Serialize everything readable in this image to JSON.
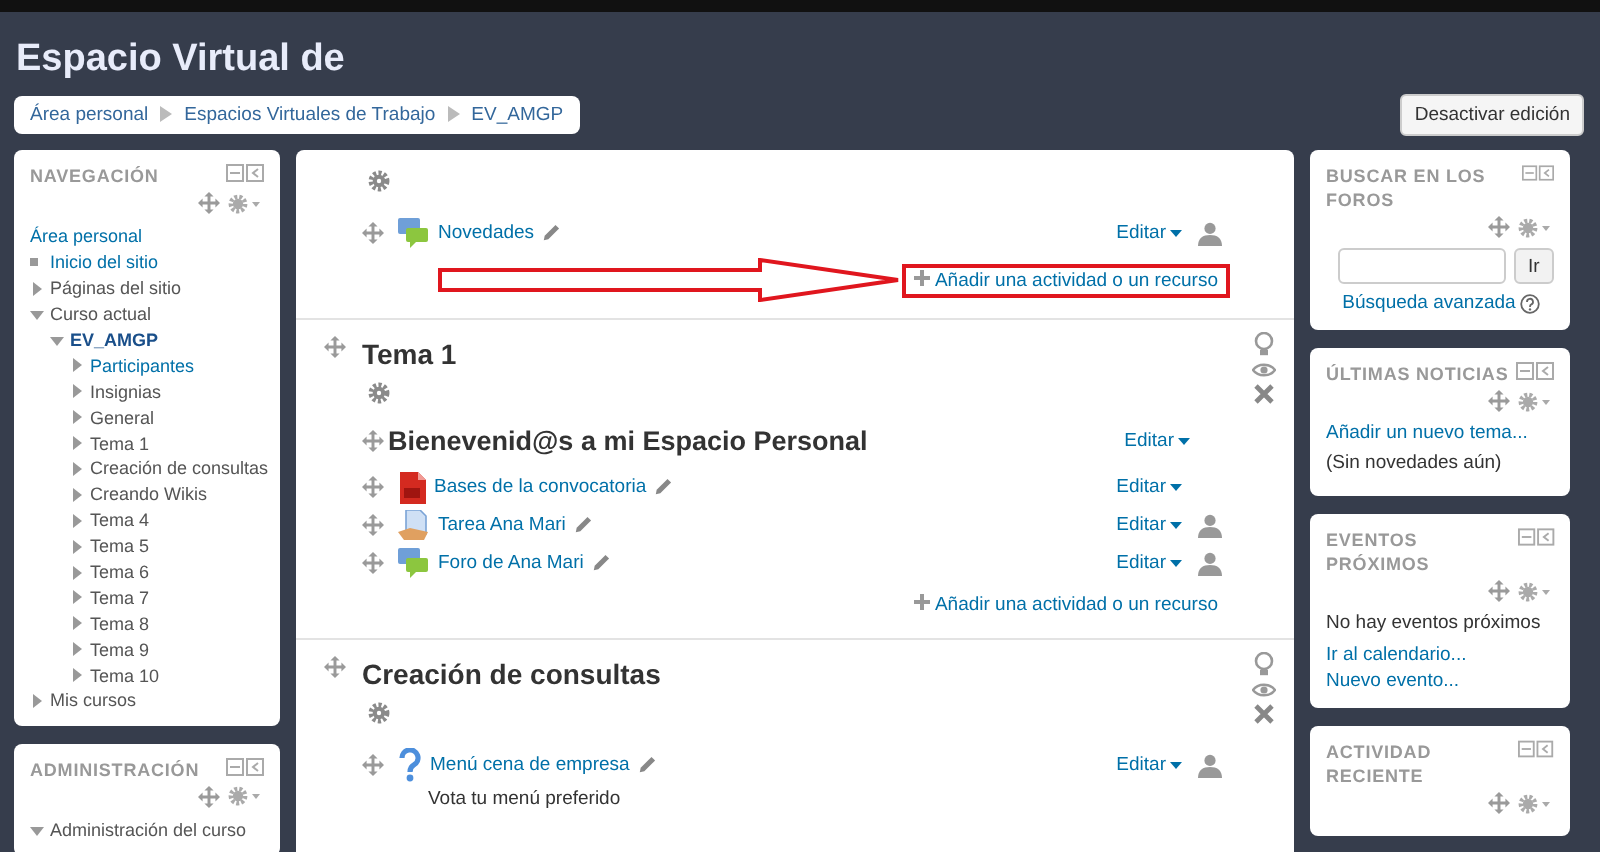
{
  "header": {
    "title": "Espacio Virtual de"
  },
  "breadcrumb": [
    {
      "label": "Área personal"
    },
    {
      "label": "Espacios Virtuales de Trabajo"
    },
    {
      "label": "EV_AMGP"
    }
  ],
  "edit_button": {
    "label": "Desactivar edición"
  },
  "navigation": {
    "title": "NAVEGACIÓN",
    "items": [
      {
        "label": "Área personal",
        "kind": "plain",
        "link": true,
        "current": false
      },
      {
        "label": "Inicio del sitio",
        "kind": "leaf",
        "link": true,
        "current": false
      },
      {
        "label": "Páginas del sitio",
        "kind": "branch",
        "link": false,
        "current": false,
        "expanded": false
      },
      {
        "label": "Curso actual",
        "kind": "branch",
        "link": false,
        "current": false,
        "expanded": true,
        "children": [
          {
            "label": "EV_AMGP",
            "kind": "branch",
            "link": true,
            "current": true,
            "expanded": true,
            "children": [
              {
                "label": "Participantes",
                "kind": "branch",
                "link": true,
                "current": false,
                "expanded": false
              },
              {
                "label": "Insignias",
                "kind": "branch",
                "link": false,
                "current": false,
                "expanded": false
              },
              {
                "label": "General",
                "kind": "branch",
                "link": false,
                "current": false,
                "expanded": false
              },
              {
                "label": "Tema 1",
                "kind": "branch",
                "link": false,
                "current": false,
                "expanded": false
              },
              {
                "label": "Creación de consultas",
                "kind": "branch",
                "link": false,
                "current": false,
                "expanded": false
              },
              {
                "label": "Creando Wikis",
                "kind": "branch",
                "link": false,
                "current": false,
                "expanded": false
              },
              {
                "label": "Tema 4",
                "kind": "branch",
                "link": false,
                "current": false,
                "expanded": false
              },
              {
                "label": "Tema 5",
                "kind": "branch",
                "link": false,
                "current": false,
                "expanded": false
              },
              {
                "label": "Tema 6",
                "kind": "branch",
                "link": false,
                "current": false,
                "expanded": false
              },
              {
                "label": "Tema 7",
                "kind": "branch",
                "link": false,
                "current": false,
                "expanded": false
              },
              {
                "label": "Tema 8",
                "kind": "branch",
                "link": false,
                "current": false,
                "expanded": false
              },
              {
                "label": "Tema 9",
                "kind": "branch",
                "link": false,
                "current": false,
                "expanded": false
              },
              {
                "label": "Tema 10",
                "kind": "branch",
                "link": false,
                "current": false,
                "expanded": false
              }
            ]
          }
        ]
      },
      {
        "label": "Mis cursos",
        "kind": "branch",
        "link": false,
        "current": false,
        "expanded": false
      }
    ]
  },
  "administration": {
    "title": "ADMINISTRACIÓN",
    "items": [
      {
        "label": "Administración del curso",
        "kind": "branch",
        "link": false,
        "current": false,
        "expanded": true
      }
    ]
  },
  "sections": [
    {
      "activities": [
        {
          "kind": "forum",
          "name": "Novedades",
          "edit": "Editar",
          "group_mode": true
        }
      ],
      "add": {
        "label": "Añadir una actividad o un recurso",
        "highlighted": true
      }
    },
    {
      "title": "Tema 1",
      "summary_heading": "Bienevenid@s a mi Espacio Personal",
      "summary_edit": "Editar",
      "activities": [
        {
          "kind": "pdf",
          "name": "Bases de la convocatoria",
          "edit": "Editar",
          "group_mode": false
        },
        {
          "kind": "assignment",
          "name": "Tarea Ana Mari",
          "edit": "Editar",
          "group_mode": true
        },
        {
          "kind": "forum",
          "name": "Foro de Ana Mari",
          "edit": "Editar",
          "group_mode": true
        }
      ],
      "add": {
        "label": "Añadir una actividad o un recurso",
        "highlighted": false
      }
    },
    {
      "title": "Creación de consultas",
      "activities": [
        {
          "kind": "choice",
          "name": "Menú cena de empresa",
          "edit": "Editar",
          "group_mode": true,
          "description": "Vota tu menú preferido"
        }
      ]
    }
  ],
  "side_blocks": [
    {
      "title": "BUSCAR EN LOS FOROS",
      "content": [
        {
          "kind": "search",
          "button": "Ir"
        },
        {
          "kind": "help_link",
          "text": "Búsqueda avanzada"
        }
      ]
    },
    {
      "title": "ÚLTIMAS NOTICIAS",
      "content": [
        {
          "kind": "link",
          "text": "Añadir un nuevo tema..."
        },
        {
          "kind": "text",
          "text": "(Sin novedades aún)"
        }
      ]
    },
    {
      "title": "EVENTOS PRÓXIMOS",
      "content": [
        {
          "kind": "text",
          "text": "No hay eventos próximos"
        },
        {
          "kind": "link",
          "text": "Ir al calendario..."
        },
        {
          "kind": "link",
          "text": "Nuevo evento..."
        }
      ]
    },
    {
      "title": "ACTIVIDAD RECIENTE"
    }
  ]
}
